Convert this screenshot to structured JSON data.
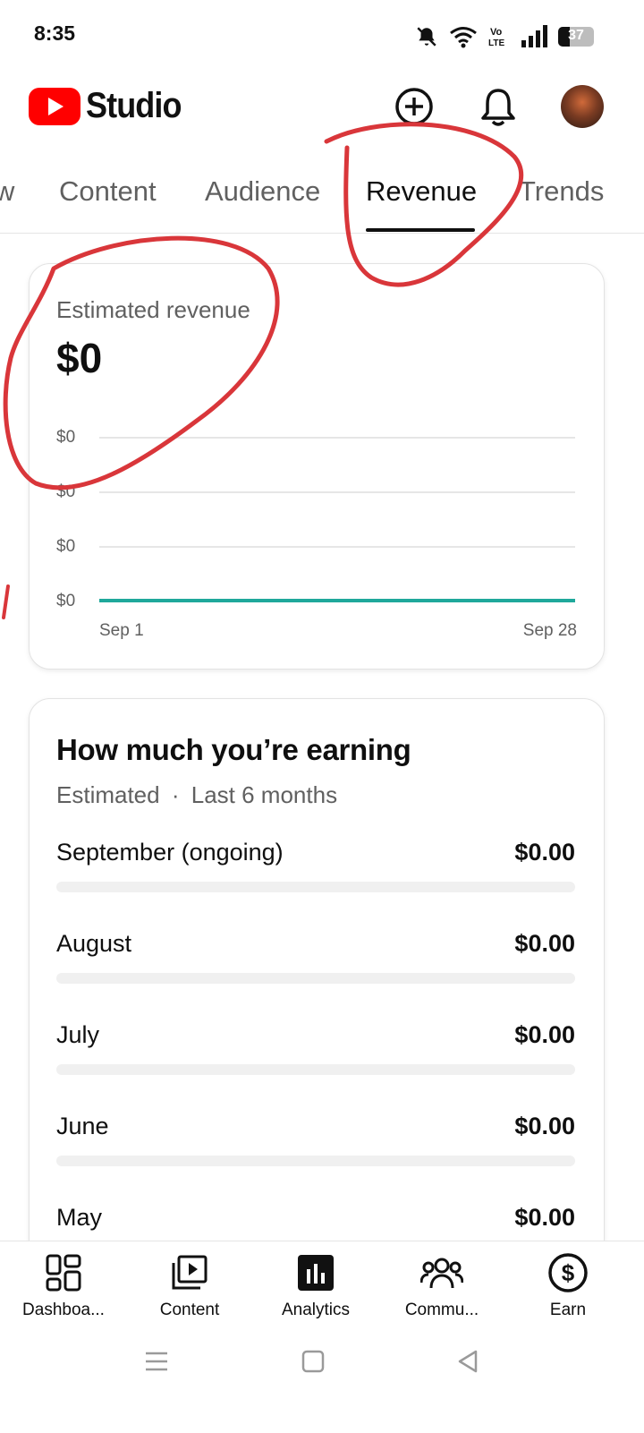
{
  "status_bar": {
    "time": "8:35",
    "battery": "37"
  },
  "header": {
    "app_name": "Studio"
  },
  "tabs": [
    {
      "label": "Overview",
      "visible_text": "w"
    },
    {
      "label": "Content"
    },
    {
      "label": "Audience"
    },
    {
      "label": "Revenue",
      "active": true
    },
    {
      "label": "Trends"
    }
  ],
  "revenue_card": {
    "label": "Estimated revenue",
    "value": "$0"
  },
  "chart_data": {
    "type": "line",
    "y_tick_labels": [
      "$0",
      "$0",
      "$0",
      "$0"
    ],
    "x_tick_labels": [
      "Sep 1",
      "Sep 28"
    ],
    "x": [
      "Sep 1",
      "Sep 28"
    ],
    "series": [
      {
        "values": [
          0,
          0
        ]
      }
    ],
    "line_color": "#1fa89b",
    "grid": true
  },
  "earnings_card": {
    "title": "How much you’re earning",
    "subtitle_left": "Estimated",
    "subtitle_sep": "·",
    "subtitle_right": "Last 6 months",
    "rows": [
      {
        "label": "September (ongoing)",
        "value": "$0.00",
        "fill": 0
      },
      {
        "label": "August",
        "value": "$0.00",
        "fill": 0
      },
      {
        "label": "July",
        "value": "$0.00",
        "fill": 0
      },
      {
        "label": "June",
        "value": "$0.00",
        "fill": 0
      },
      {
        "label": "May",
        "value": "$0.00",
        "fill": 0
      }
    ]
  },
  "bottom_nav": [
    {
      "label": "Dashboa...",
      "icon": "dashboard-icon"
    },
    {
      "label": "Content",
      "icon": "content-icon"
    },
    {
      "label": "Analytics",
      "icon": "analytics-icon",
      "active": true
    },
    {
      "label": "Commu...",
      "icon": "community-icon"
    },
    {
      "label": "Earn",
      "icon": "earn-icon"
    }
  ],
  "colors": {
    "brand_red": "#ff0000",
    "annotation_red": "#d9363a",
    "chart_line": "#1fa89b"
  }
}
